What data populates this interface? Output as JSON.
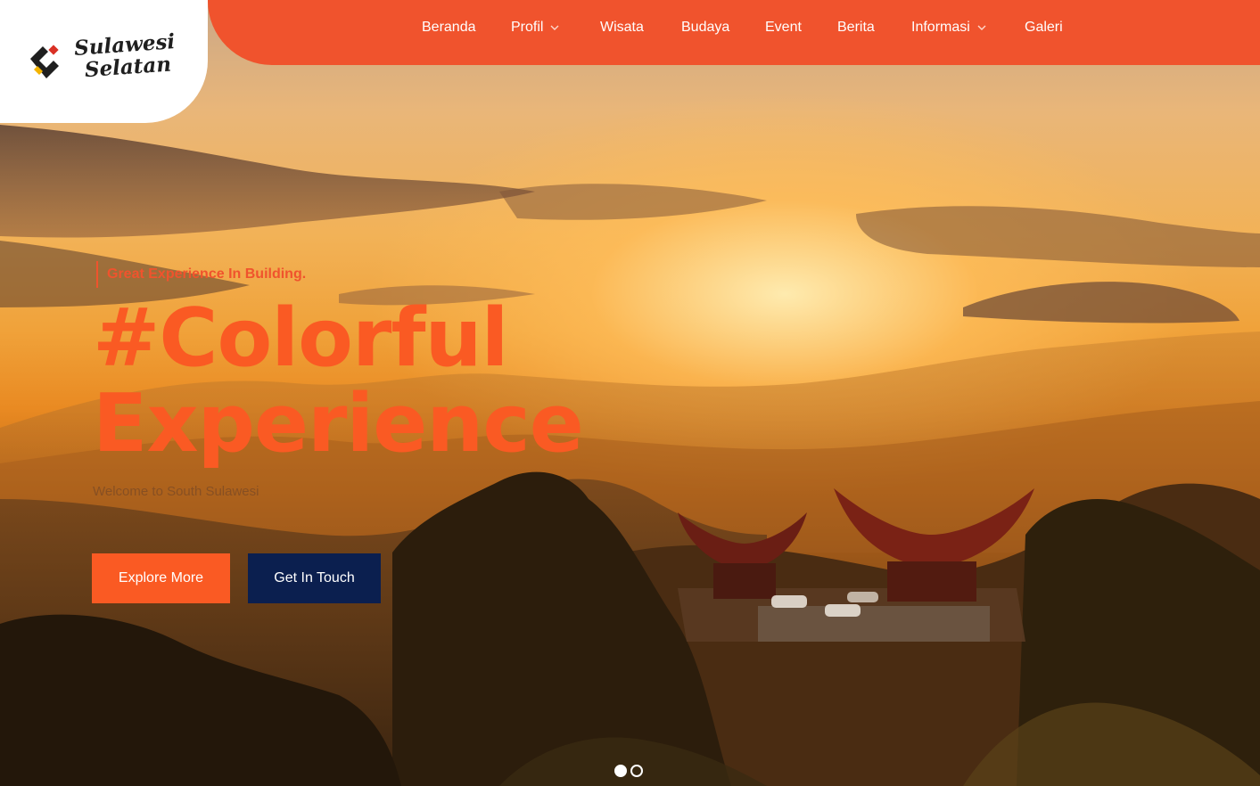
{
  "brand": {
    "logo_line1": "Sulawesi",
    "logo_line2": "Selatan",
    "colors": {
      "accent": "#f0532d",
      "headline": "#fa5a23",
      "dark_button": "#0b1f4f"
    }
  },
  "nav": {
    "items": [
      {
        "label": "Beranda",
        "dropdown": false
      },
      {
        "label": "Profil",
        "dropdown": true
      },
      {
        "label": "Wisata",
        "dropdown": false
      },
      {
        "label": "Budaya",
        "dropdown": false
      },
      {
        "label": "Event",
        "dropdown": false
      },
      {
        "label": "Berita",
        "dropdown": false
      },
      {
        "label": "Informasi",
        "dropdown": true
      },
      {
        "label": "Galeri",
        "dropdown": false
      }
    ],
    "dropdown_icon": "chevron-down-icon"
  },
  "hero": {
    "kicker": "Great Experience In Building.",
    "headline_line1": "#Colorful",
    "headline_line2": "Experience",
    "subtitle": "Welcome to South Sulawesi",
    "primary_button": "Explore More",
    "secondary_button": "Get In Touch",
    "slides": {
      "total": 2,
      "active": 1
    }
  }
}
